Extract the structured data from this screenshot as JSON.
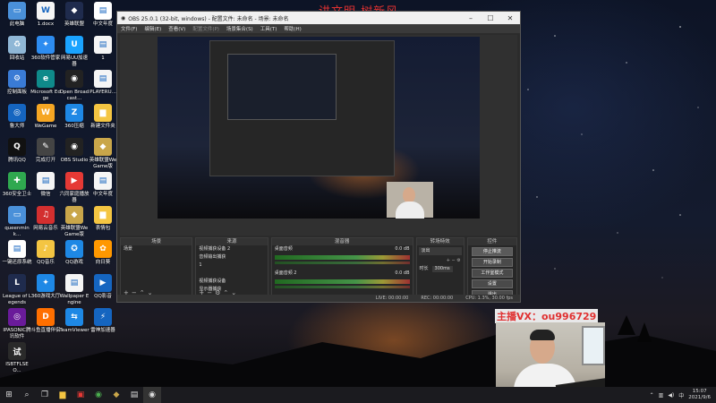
{
  "watermark": "讲文明 树新风",
  "caption": "主播VX：ou996729",
  "desktop_icons": [
    {
      "label": "此电脑",
      "color": "#4a90d9",
      "glyph": "▭"
    },
    {
      "label": "1.docx",
      "color": "#f5f5f5",
      "glyph": "W"
    },
    {
      "label": "英雄联盟",
      "color": "#1f2b4d",
      "glyph": "◆"
    },
    {
      "label": "中文年度",
      "color": "#ffffff",
      "glyph": "▤"
    },
    {
      "label": "回收站",
      "color": "#8fb7d6",
      "glyph": "♻"
    },
    {
      "label": "360软件管家",
      "color": "#2d8cf0",
      "glyph": "✦"
    },
    {
      "label": "网易UU加速器",
      "color": "#1aa3ff",
      "glyph": "U"
    },
    {
      "label": "1",
      "color": "#f5f5f5",
      "glyph": "▤"
    },
    {
      "label": "控制面板",
      "color": "#3a7bd5",
      "glyph": "⚙"
    },
    {
      "label": "Microsoft Edge",
      "color": "#0f8a8a",
      "glyph": "e"
    },
    {
      "label": "Open Broadcast...",
      "color": "#222",
      "glyph": "◉"
    },
    {
      "label": "PLAYERU...",
      "color": "#f5f5f5",
      "glyph": "▤"
    },
    {
      "label": "鲁大师",
      "color": "#1565c0",
      "glyph": "◎"
    },
    {
      "label": "WeGame",
      "color": "#f5a623",
      "glyph": "W"
    },
    {
      "label": "360压缩",
      "color": "#1e88e5",
      "glyph": "Z"
    },
    {
      "label": "新建文件夹",
      "color": "#f4c542",
      "glyph": "▆"
    },
    {
      "label": "腾讯QQ",
      "color": "#111",
      "glyph": "Q"
    },
    {
      "label": "完成打开",
      "color": "#444",
      "glyph": "✎"
    },
    {
      "label": "OBS Studio",
      "color": "#222",
      "glyph": "◉"
    },
    {
      "label": "英雄联盟WeGame版",
      "color": "#c9a64a",
      "glyph": "◆"
    },
    {
      "label": "360安全卫士",
      "color": "#2fa84f",
      "glyph": "✚"
    },
    {
      "label": "微信",
      "color": "#f5f5f5",
      "glyph": "▤"
    },
    {
      "label": "六同家庭播放器",
      "color": "#e53935",
      "glyph": "▶"
    },
    {
      "label": "中文年度",
      "color": "#f5f5f5",
      "glyph": "▤"
    },
    {
      "label": "queenmink...",
      "color": "#4a90d9",
      "glyph": "▭"
    },
    {
      "label": "网易云音乐",
      "color": "#d32f2f",
      "glyph": "♫"
    },
    {
      "label": "英雄联盟WeGame版",
      "color": "#c9a64a",
      "glyph": "◆"
    },
    {
      "label": "表情包",
      "color": "#f4c542",
      "glyph": "▆"
    },
    {
      "label": "一键还原系统",
      "color": "#ffffff",
      "glyph": "▤"
    },
    {
      "label": "QQ音乐",
      "color": "#f4c542",
      "glyph": "♪"
    },
    {
      "label": "QQ游戏",
      "color": "#1e88e5",
      "glyph": "✪"
    },
    {
      "label": "向日葵",
      "color": "#ff9800",
      "glyph": "✿"
    },
    {
      "label": "League of Legends",
      "color": "#1f2b4d",
      "glyph": "L"
    },
    {
      "label": "360游戏大厅",
      "color": "#1e88e5",
      "glyph": "✦"
    },
    {
      "label": "Wallpaper Engine",
      "color": "#f5f5f5",
      "glyph": "▤"
    },
    {
      "label": "QQ影音",
      "color": "#1565c0",
      "glyph": "▶"
    },
    {
      "label": "IPASONIC腾讯软件",
      "color": "#6a1b9a",
      "glyph": "◎"
    },
    {
      "label": "斗鱼直播伴侣",
      "color": "#ff6f00",
      "glyph": "D"
    },
    {
      "label": "TeamViewer",
      "color": "#1e88e5",
      "glyph": "⇆"
    },
    {
      "label": "雷神加速器",
      "color": "#1565c0",
      "glyph": "⚡"
    },
    {
      "label": "ISBTFLSEO...",
      "color": "#2a2a2a",
      "glyph": "试"
    }
  ],
  "obs": {
    "title": "OBS 25.0.1 (32-bit, windows) - 配置文件: 未命名 - 场景: 未命名",
    "menu": [
      "文件(F)",
      "编辑(E)",
      "查看(V)",
      "配置文件(P)",
      "场景集合(S)",
      "工具(T)",
      "帮助(H)"
    ],
    "panels": {
      "scenes": {
        "title": "场景",
        "items": [
          "场景"
        ]
      },
      "sources": {
        "title": "来源",
        "items": [
          "视频捕获设备 2",
          "音频输出捕获",
          "1",
          "",
          "视频捕获设备",
          "显示器捕获"
        ]
      },
      "mixer": {
        "title": "混音器",
        "tracks": [
          {
            "name": "桌面音频",
            "db": "0.0 dB"
          },
          {
            "name": "桌面音频 2",
            "db": "0.0 dB"
          }
        ]
      },
      "transitions": {
        "title": "转场特效",
        "mode": "淡出",
        "duration_label": "时长",
        "duration": "300ms"
      },
      "controls": {
        "title": "控件",
        "buttons": [
          "停止推流",
          "开始录制",
          "工作室模式",
          "设置",
          "退出"
        ]
      }
    },
    "status": {
      "live": "LIVE: 00:00:00",
      "rec": "REC: 00:00:00",
      "cpu": "CPU: 1.3%, 30.00 fps"
    }
  },
  "taskbar": {
    "time": "15:07",
    "date": "2021/9/6"
  }
}
